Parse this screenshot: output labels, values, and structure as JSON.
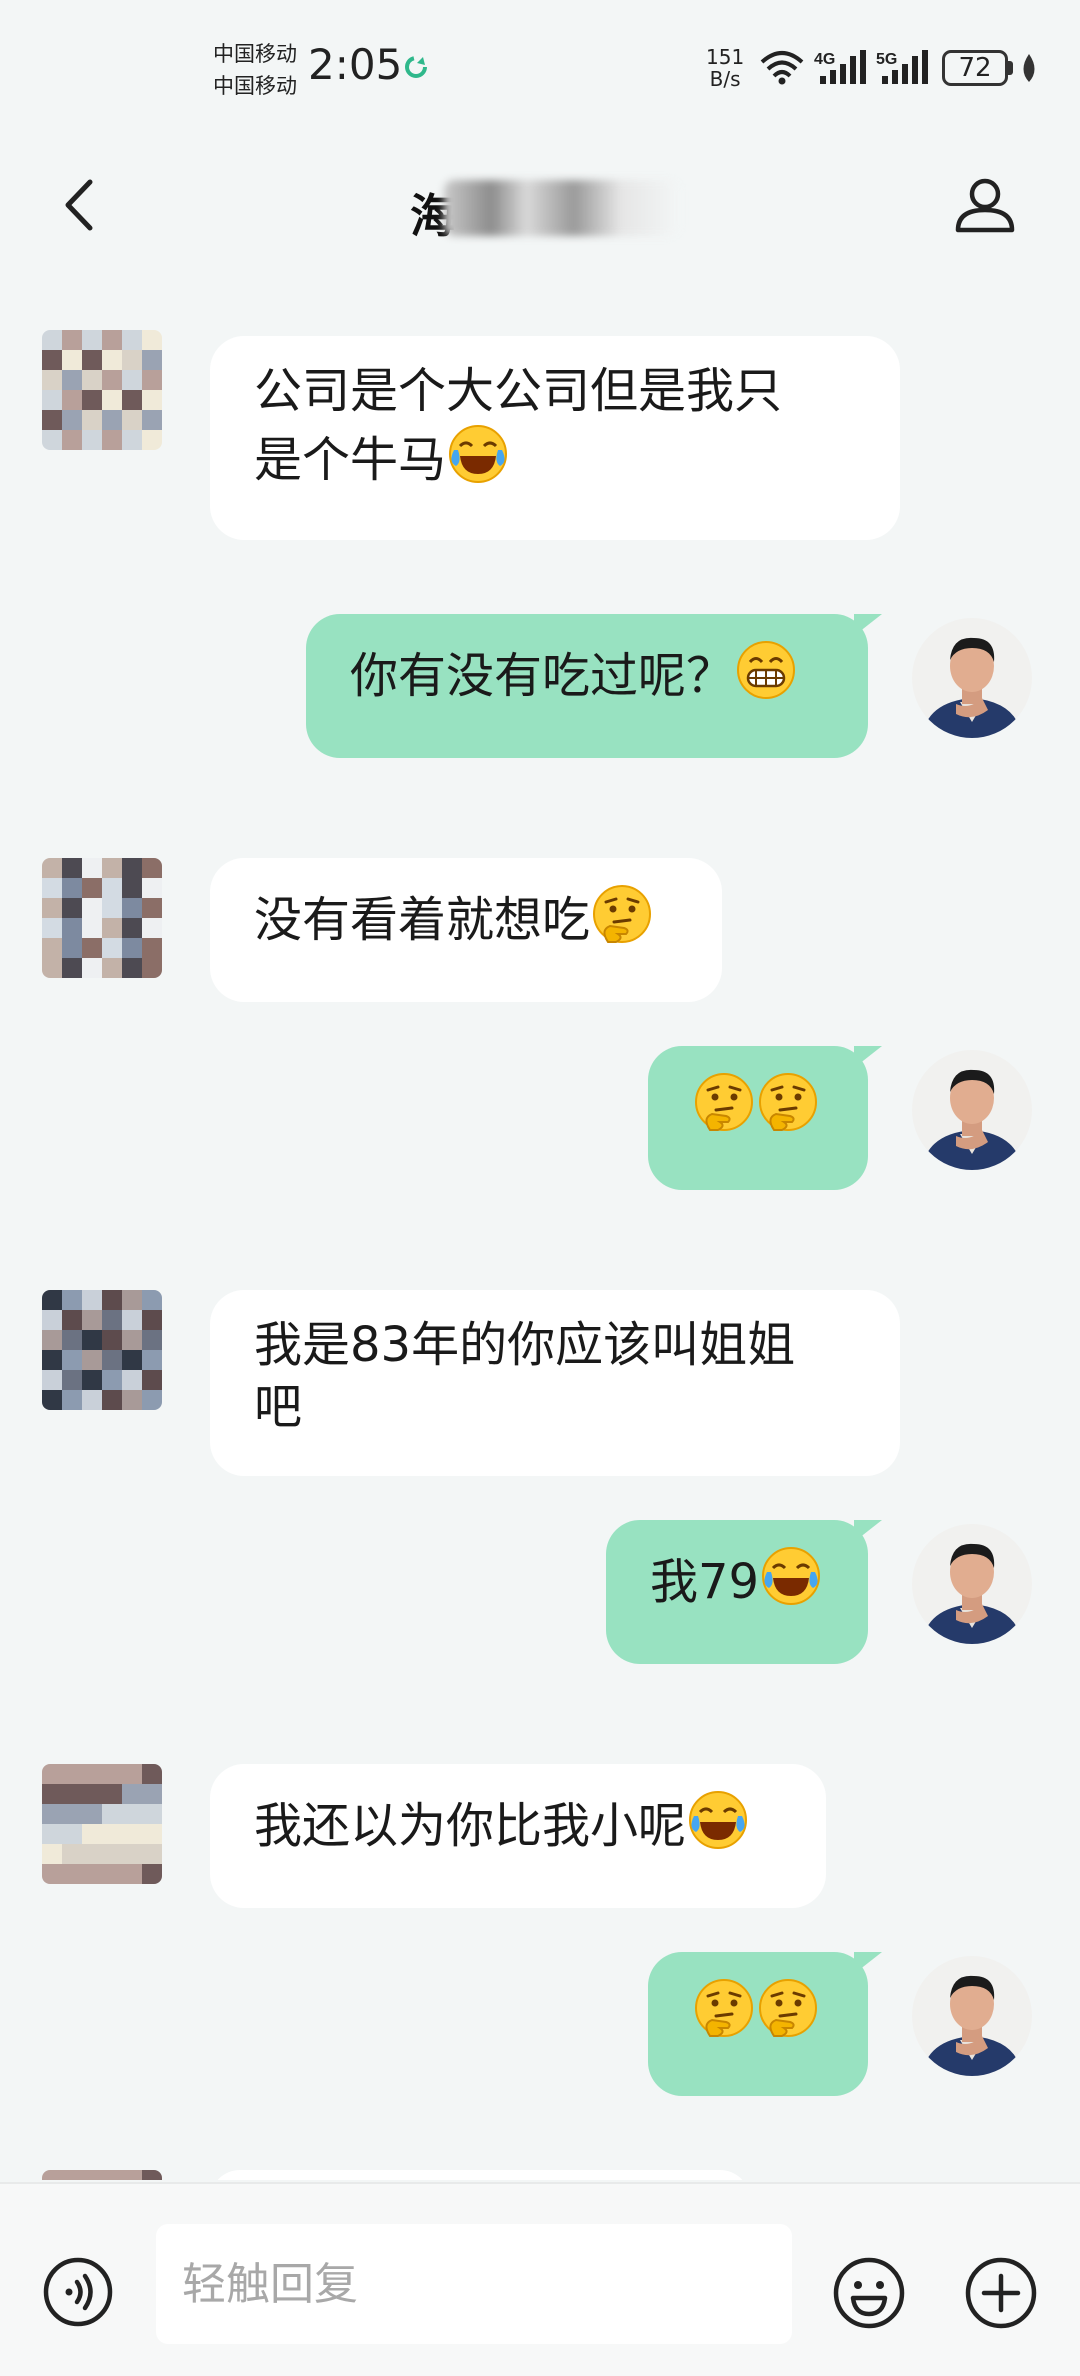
{
  "status_bar": {
    "carrier_1": "中国移动",
    "carrier_2": "中国移动",
    "time": "2:05",
    "net_speed_value": "151",
    "net_speed_unit": "B/s",
    "signal_1": "4G",
    "signal_2": "5G",
    "battery_level": "72"
  },
  "header": {
    "contact_name_visible": "海",
    "back_icon": "chevron-left-icon",
    "profile_icon": "person-icon"
  },
  "messages": [
    {
      "side": "left",
      "lines": [
        "公司是个大公司但是我只",
        "是个牛马"
      ],
      "emoji": [
        "laughing-crying"
      ]
    },
    {
      "side": "right",
      "lines": [
        "你有没有吃过呢？"
      ],
      "emoji": [
        "grinning"
      ]
    },
    {
      "side": "left",
      "lines": [
        "没有看着就想吃"
      ],
      "emoji": [
        "thinking"
      ]
    },
    {
      "side": "right",
      "lines": [
        ""
      ],
      "emoji": [
        "thinking",
        "thinking"
      ]
    },
    {
      "side": "left",
      "lines": [
        "我是83年的你应该叫姐姐",
        "吧"
      ],
      "emoji": []
    },
    {
      "side": "right",
      "lines": [
        "我79"
      ],
      "emoji": [
        "laughing-crying"
      ]
    },
    {
      "side": "left",
      "lines": [
        "我还以为你比我小呢"
      ],
      "emoji": [
        "laughing-crying"
      ]
    },
    {
      "side": "right",
      "lines": [
        ""
      ],
      "emoji": [
        "thinking",
        "thinking"
      ]
    }
  ],
  "input_bar": {
    "placeholder": "轻触回复",
    "voice_icon": "voice-icon",
    "emoji_icon": "smiley-icon",
    "plus_icon": "plus-icon"
  },
  "colors": {
    "background": "#f3f6f6",
    "bubble_self": "#98e2c1",
    "bubble_other": "#ffffff"
  }
}
